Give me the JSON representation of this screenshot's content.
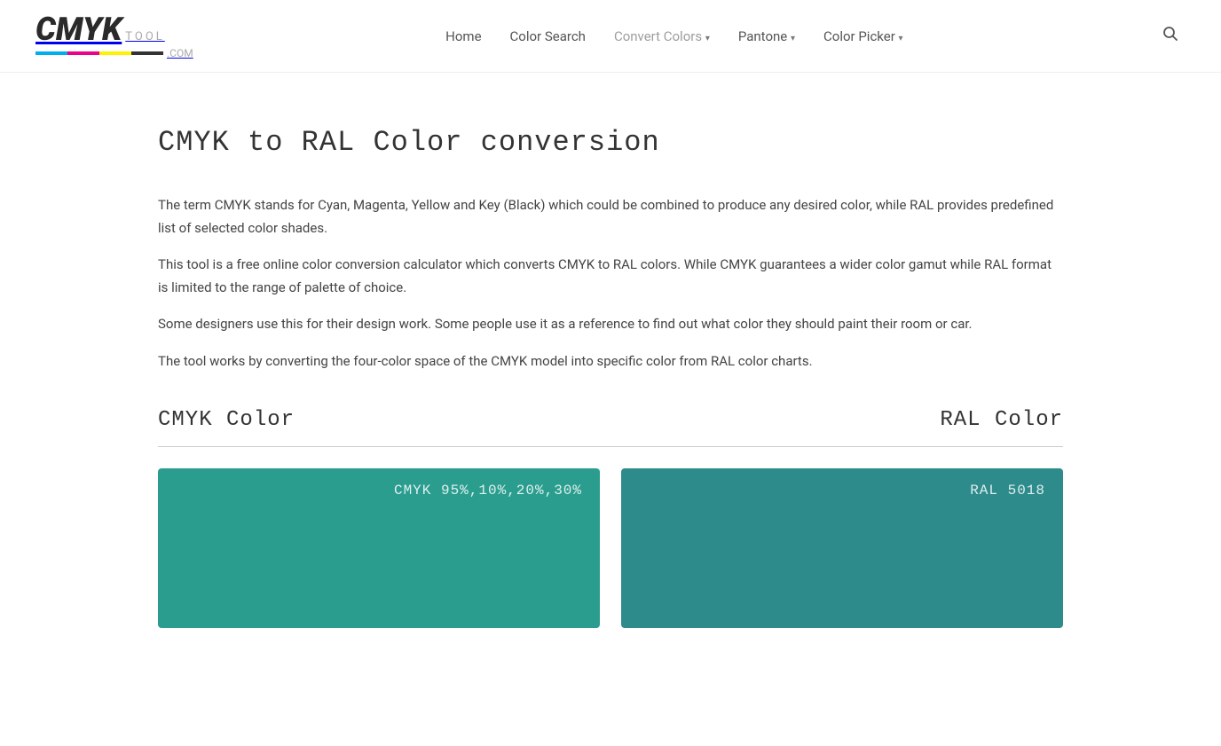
{
  "site": {
    "logo_cmyk": "CMYK",
    "logo_tool": "TOOL",
    "logo_dotcom": ".COM"
  },
  "nav": {
    "home_label": "Home",
    "color_search_label": "Color Search",
    "convert_colors_label": "Convert Colors",
    "pantone_label": "Pantone",
    "color_picker_label": "Color Picker"
  },
  "page": {
    "title": "CMYK to RAL Color conversion",
    "desc1": "The term CMYK stands for Cyan, Magenta, Yellow and Key (Black) which could be combined to produce any desired color, while RAL provides predefined list of selected color shades.",
    "desc2": "This tool is a free online color conversion calculator which converts CMYK to RAL colors. While CMYK guarantees a wider color gamut while RAL format is limited to the range of palette of choice.",
    "desc3": "Some designers use this for their design work. Some people use it as a reference to find out what color they should paint their room or car.",
    "desc4": "The tool works by converting the four-color space of the CMYK model into specific color from RAL color charts.",
    "cmyk_color_header": "CMYK Color",
    "ral_color_header": "RAL Color",
    "cmyk_value_label": "CMYK 95%,10%,20%,30%",
    "ral_value_label": "RAL 5018",
    "cmyk_box_color": "#2a9d8f",
    "ral_box_color": "#2e8b8b"
  }
}
